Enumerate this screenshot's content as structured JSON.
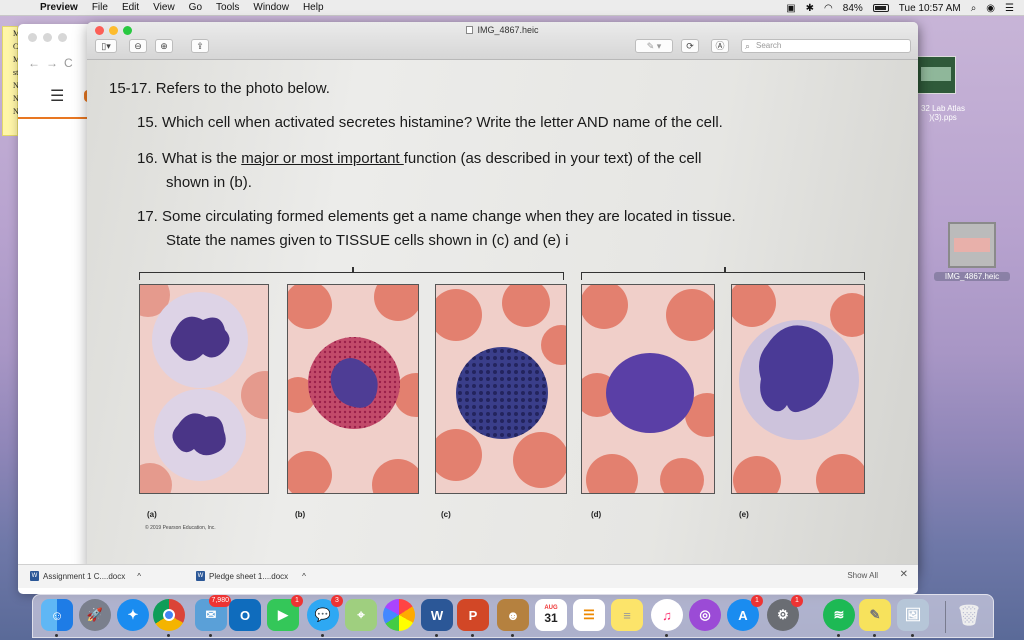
{
  "menubar": {
    "app": "Preview",
    "items": [
      "File",
      "Edit",
      "View",
      "Go",
      "Tools",
      "Window",
      "Help"
    ],
    "battery": "84%",
    "time": "Tue 10:57 AM"
  },
  "sticky": {
    "lines": [
      "M",
      "C",
      "M",
      "st",
      "N",
      "N",
      "N"
    ]
  },
  "preview": {
    "title": "IMG_4867.heic",
    "search_placeholder": "Search"
  },
  "document": {
    "header": "15-17.  Refers to the photo below.",
    "q15": "15.  Which cell when activated secretes histamine?  Write the letter AND name of the cell.",
    "q16_a": "16. What is the ",
    "q16_u": "major or most important ",
    "q16_b": "function (as described in your text) of the cell",
    "q16_line2": "shown in (b).",
    "q17_line1": "17.  Some circulating formed elements get a name change when they are located in tissue.",
    "q17_line2": "State the names given to TISSUE cells shown in (c) and (e) i",
    "labels": [
      "(a)",
      "(b)",
      "(c)",
      "(d)",
      "(e)"
    ],
    "copyright": "© 2019 Pearson Education, Inc."
  },
  "desktop": {
    "icon1_label_line1": "32 Lab Atlas",
    "icon1_label_line2": ")(3).pps",
    "icon2_label": "IMG_4867.heic"
  },
  "downloads": {
    "item1": "Assignment 1 C....docx",
    "item2": "Pledge sheet 1....docx",
    "show_all": "Show All"
  },
  "dock": {
    "badges": {
      "contacts": "7,980",
      "facetime": "1",
      "messages": "3",
      "appstore": "1",
      "prefs": "1"
    },
    "calendar_day": "31",
    "calendar_month": "AUG"
  },
  "colors": {
    "cell_background": "#f2d4cf",
    "rbc": "#e08072",
    "nucleus": "#5a3f93"
  }
}
